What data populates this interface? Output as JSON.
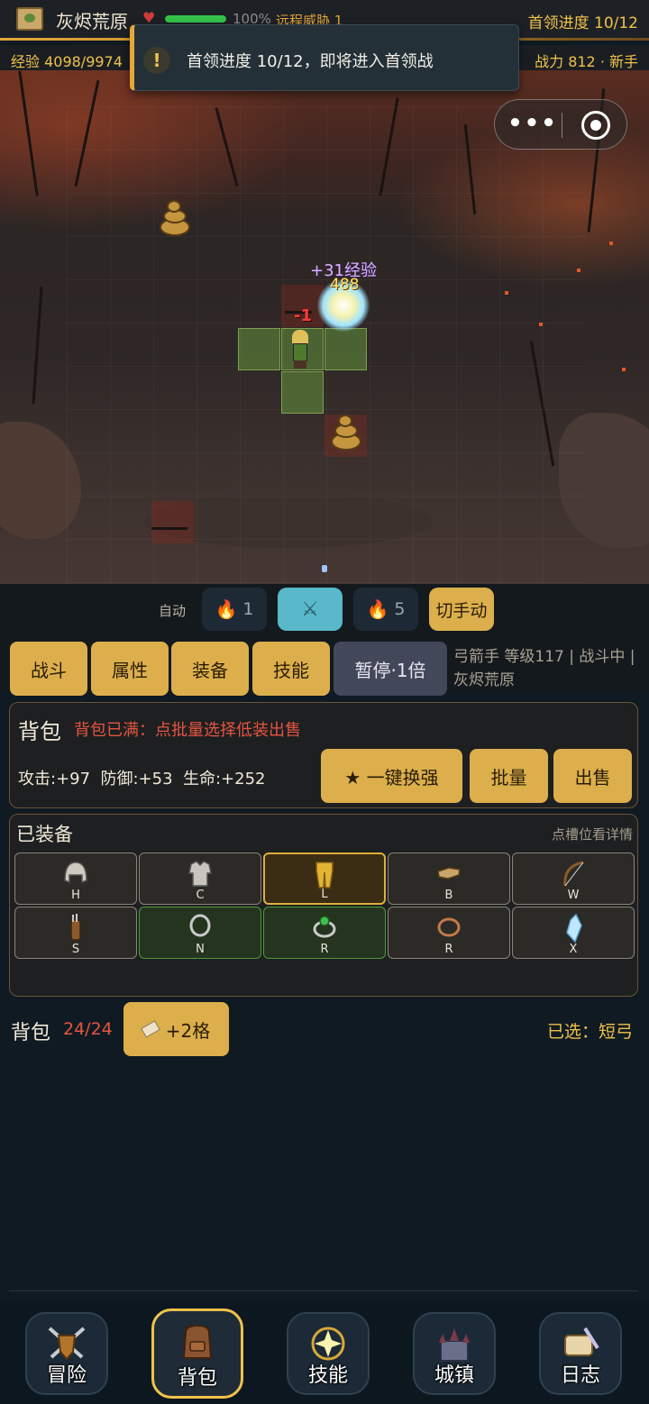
{
  "header": {
    "zone_name": "灰烬荒原",
    "hp_percent": 100,
    "hp_text": "100%",
    "threat": "远程威胁 1",
    "boss_progress": "首领进度 10/12",
    "exp": "经验 4098/9974",
    "power": "战力 812 · 新手"
  },
  "toast": {
    "icon": "!",
    "text": "首领进度 10/12，即将进入首领战"
  },
  "capsule": {
    "more_icon": "•••"
  },
  "battle": {
    "exp_gain": "+31经验",
    "damage_dealt": "488",
    "damage_taken": "-1"
  },
  "controls": {
    "auto_label": "自动",
    "skill1_count": "1",
    "skill2_count": "5",
    "attack_icon": "⚔",
    "manual_button": "切手动"
  },
  "tabs": {
    "battle": "战斗",
    "attributes": "属性",
    "equipment": "装备",
    "skills": "技能",
    "pause": "暂停·1倍"
  },
  "character_info": "弓箭手 等级117 | 战斗中 | 灰烬荒原",
  "bag_panel": {
    "title": "背包",
    "warning": "背包已满：点批量选择低装出售",
    "stats": "攻击:+97  防御:+53  生命:+252",
    "auto_equip_button": "★ 一键换强",
    "batch_button": "批量",
    "sell_button": "出售"
  },
  "equipped": {
    "title": "已装备",
    "hint": "点槽位看详情",
    "slots": [
      {
        "letter": "H",
        "icon": "helmet-icon"
      },
      {
        "letter": "C",
        "icon": "chest-armor-icon"
      },
      {
        "letter": "L",
        "icon": "leg-armor-icon"
      },
      {
        "letter": "B",
        "icon": "boots-icon"
      },
      {
        "letter": "W",
        "icon": "bow-icon"
      },
      {
        "letter": "S",
        "icon": "quiver-icon"
      },
      {
        "letter": "N",
        "icon": "necklace-icon"
      },
      {
        "letter": "R",
        "icon": "emerald-ring-icon"
      },
      {
        "letter": "R",
        "icon": "copper-ring-icon"
      },
      {
        "letter": "X",
        "icon": "ice-crystal-icon"
      }
    ]
  },
  "backpack": {
    "label": "背包",
    "count": "24/24",
    "expand_button": "+2格",
    "selected": "已选：短弓"
  },
  "nav": [
    {
      "label": "冒险",
      "icon": "crossed-swords-shield-icon"
    },
    {
      "label": "背包",
      "icon": "backpack-icon"
    },
    {
      "label": "技能",
      "icon": "star-burst-icon"
    },
    {
      "label": "城镇",
      "icon": "castle-icon"
    },
    {
      "label": "日志",
      "icon": "scroll-quill-icon"
    }
  ],
  "colors": {
    "accent_gold": "#dcaf4c",
    "warning_red": "#e6553f",
    "hp_green": "#35c24a"
  }
}
